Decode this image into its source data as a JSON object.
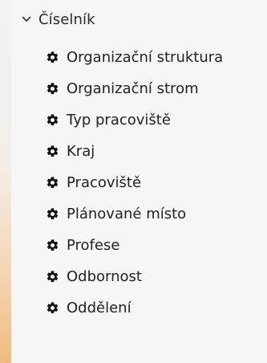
{
  "tree": {
    "header_label": "Číselník",
    "items": [
      {
        "label": "Organizační struktura"
      },
      {
        "label": "Organizační strom"
      },
      {
        "label": "Typ pracoviště"
      },
      {
        "label": "Kraj"
      },
      {
        "label": "Pracoviště"
      },
      {
        "label": "Plánované místo"
      },
      {
        "label": "Profese"
      },
      {
        "label": "Odbornost"
      },
      {
        "label": "Oddělení"
      }
    ]
  },
  "icons": {
    "header": "chevron-down-icon",
    "items": "gear-icon"
  },
  "colors": {
    "text": "#222222",
    "icon": "#111111",
    "panel_background": "#f6f6f6"
  }
}
